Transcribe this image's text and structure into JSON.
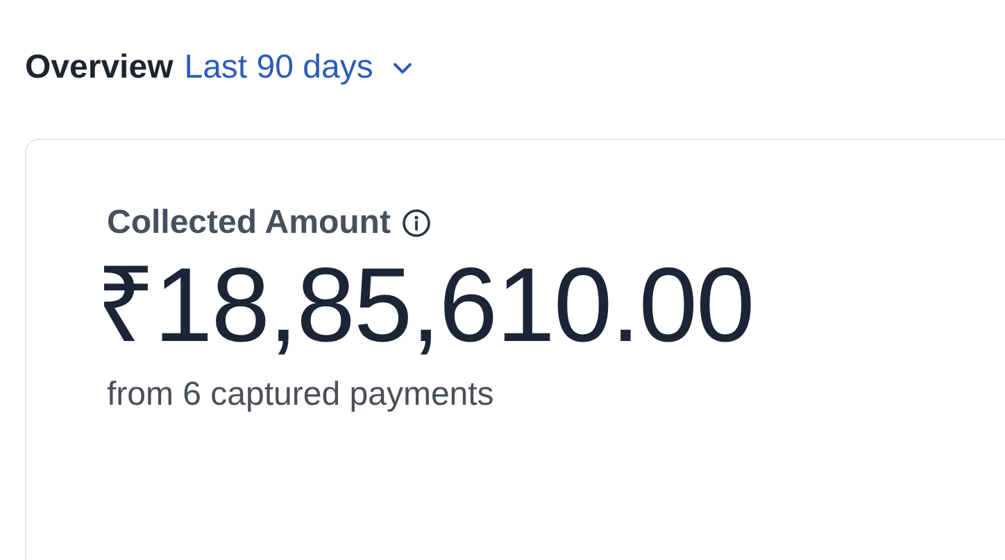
{
  "header": {
    "title": "Overview",
    "period": "Last 90 days"
  },
  "card": {
    "label": "Collected Amount",
    "amount": "₹18,85,610.00",
    "subtitle": "from 6 captured payments"
  }
}
